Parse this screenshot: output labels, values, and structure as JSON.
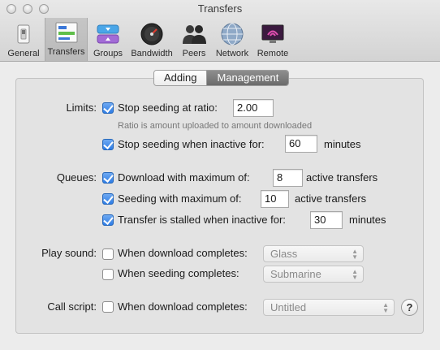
{
  "window": {
    "title": "Transfers"
  },
  "toolbar": {
    "items": [
      {
        "label": "General",
        "icon": "switch-icon"
      },
      {
        "label": "Transfers",
        "icon": "transfers-icon",
        "selected": true
      },
      {
        "label": "Groups",
        "icon": "groups-icon"
      },
      {
        "label": "Bandwidth",
        "icon": "speedometer-icon"
      },
      {
        "label": "Peers",
        "icon": "people-icon"
      },
      {
        "label": "Network",
        "icon": "globe-icon"
      },
      {
        "label": "Remote",
        "icon": "monitor-wifi-icon"
      }
    ]
  },
  "tabs": [
    {
      "label": "Adding",
      "active": false
    },
    {
      "label": "Management",
      "active": true
    }
  ],
  "limits": {
    "label": "Limits:",
    "ratio": {
      "label": "Stop seeding at ratio:",
      "checked": true,
      "value": "2.00",
      "hint": "Ratio is amount uploaded to amount downloaded"
    },
    "inactive": {
      "label": "Stop seeding when inactive for:",
      "checked": true,
      "value": "60",
      "unit": "minutes"
    }
  },
  "queues": {
    "label": "Queues:",
    "download": {
      "label": "Download with maximum of:",
      "checked": true,
      "value": "8",
      "unit": "active transfers"
    },
    "seeding": {
      "label": "Seeding with maximum of:",
      "checked": true,
      "value": "10",
      "unit": "active transfers"
    },
    "stalled": {
      "label": "Transfer is stalled when inactive for:",
      "checked": true,
      "value": "30",
      "unit": "minutes"
    }
  },
  "sound": {
    "label": "Play sound:",
    "download": {
      "label": "When download completes:",
      "checked": false,
      "value": "Glass"
    },
    "seeding": {
      "label": "When seeding completes:",
      "checked": false,
      "value": "Submarine"
    }
  },
  "script": {
    "label": "Call script:",
    "download": {
      "label": "When download completes:",
      "checked": false,
      "value": "Untitled"
    },
    "help": "?"
  },
  "colors": {
    "accent": "#2e7de6",
    "selected_tab": "#7a7a7a"
  }
}
